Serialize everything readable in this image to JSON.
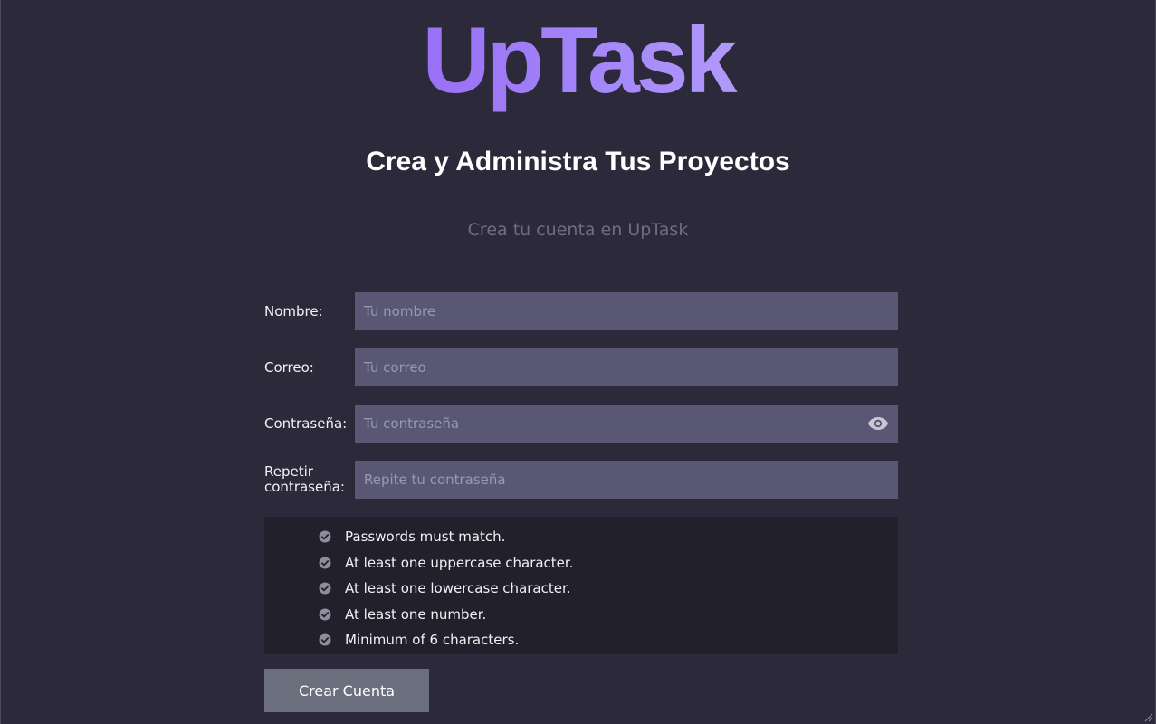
{
  "brand": {
    "logo_text": "UpTask"
  },
  "header": {
    "headline": "Crea y Administra Tus Proyectos",
    "subtitle": "Crea tu cuenta en UpTask"
  },
  "form": {
    "fields": [
      {
        "label": "Nombre:",
        "placeholder": "Tu nombre",
        "value": ""
      },
      {
        "label": "Correo:",
        "placeholder": "Tu correo",
        "value": ""
      },
      {
        "label": "Contraseña:",
        "placeholder": "Tu contraseña",
        "value": "",
        "icon": "eye-icon"
      },
      {
        "label_line1": "Repetir",
        "label_line2": "contraseña:",
        "placeholder": "Repite tu contraseña",
        "value": ""
      }
    ],
    "password_rules": [
      "Passwords must match.",
      "At least one uppercase character.",
      "At least one lowercase character.",
      "At least one number.",
      "Minimum of 6 characters."
    ],
    "submit_label": "Crear Cuenta"
  },
  "colors": {
    "background": "#2c2a3a",
    "input_bg": "#5a5774",
    "rules_bg": "#21202b",
    "button_bg": "#6b6f7d",
    "logo_gradient_start": "#7c3aed",
    "logo_gradient_end": "#ddd6fe"
  }
}
